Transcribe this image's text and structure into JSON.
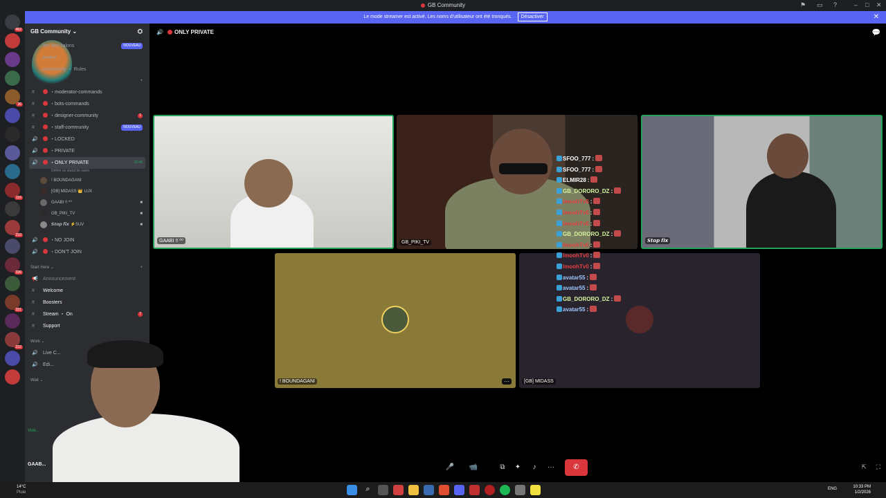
{
  "window": {
    "title": "GB Community",
    "controls": [
      "–",
      "□",
      "✕"
    ]
  },
  "banner": {
    "text": "Le mode streamer est activé. Les noms d'utilisateur ont été tronqués.",
    "button": "Désactiver"
  },
  "server": {
    "name": "GB Community ⌄",
    "top_items": [
      {
        "label": "...ber des salons",
        "badge": "NOUVEAU"
      },
      {
        "label": "...erveur",
        "badge": ""
      },
      {
        "label": "...community ・ Rules",
        "badge": ""
      }
    ],
    "categories": [
      {
        "title": "",
        "channels": [
          {
            "label": "・moderator-commands",
            "badge": ""
          },
          {
            "label": "・bots-commands",
            "badge": ""
          },
          {
            "label": "・designer-community",
            "badge": "1"
          },
          {
            "label": "・staff-community",
            "badge": "NOUVEAU"
          },
          {
            "label": "・LOCKED",
            "badge": ""
          },
          {
            "label": "・PRIVATE",
            "badge": ""
          }
        ]
      }
    ],
    "active_channel": {
      "label": "・ONLY PRIVATE",
      "duration": "32:46",
      "status": "Définir un statut de salon"
    },
    "voice_users": [
      {
        "name": "! BOUNDAGANI",
        "cam": false
      },
      {
        "name": "[GB] MIDASS 👑 LUX",
        "cam": false
      },
      {
        "name": "GAABI !! ⁰⁰",
        "cam": true
      },
      {
        "name": "GB_PIKI_TV",
        "cam": true
      },
      {
        "name": "𝙎𝙩𝙤𝙥 𝙛𝙞𝙭 ⚡SUV",
        "cam": true
      }
    ],
    "after_channels": [
      {
        "label": "・NO JOIN"
      },
      {
        "label": "・DON'T JOIN"
      }
    ],
    "start_here": {
      "title": "Start Here ⌄",
      "channels": [
        {
          "label": "Announcement",
          "badge": ""
        },
        {
          "label": "Welcome",
          "badge": ""
        },
        {
          "label": "Boosters",
          "badge": ""
        },
        {
          "label": "Stream ・ On",
          "badge": "7"
        },
        {
          "label": "Support",
          "badge": ""
        }
      ]
    },
    "work": {
      "title": "Work ⌄",
      "channels": [
        {
          "label": "Live C..."
        },
        {
          "label": "Edi..."
        }
      ]
    },
    "wait": {
      "title": "Wait ⌄"
    },
    "user_panel": {
      "name": "GAAB...",
      "video_label": "Vidé..."
    }
  },
  "call": {
    "channel_title": "ONLY PRIVATE",
    "tiles": [
      {
        "name": "GAABI !! ⁰⁰"
      },
      {
        "name": "GB_PIKI_TV"
      },
      {
        "name": "𝙎𝙩𝙤𝙥 𝙛𝙞𝙭"
      },
      {
        "name": "! BOUNDAGANI"
      },
      {
        "name": "[GB] MIDASS"
      }
    ],
    "more_label": "···"
  },
  "stream_chat": [
    {
      "user": "SFOO_777",
      "color": "#ffffff",
      "sep": ":"
    },
    {
      "user": "SFOO_777",
      "color": "#ffffff",
      "sep": ":"
    },
    {
      "user": "ELMIR28",
      "color": "#ffffff",
      "sep": ":"
    },
    {
      "user": "GB_DORORO_DZ",
      "color": "#d6f5a0",
      "sep": ":"
    },
    {
      "user": "lmoohTv0",
      "color": "#e04040",
      "sep": ":"
    },
    {
      "user": "lmoohTv0",
      "color": "#e04040",
      "sep": ":"
    },
    {
      "user": "lmoohTv0",
      "color": "#e04040",
      "sep": ":"
    },
    {
      "user": "GB_DORORO_DZ",
      "color": "#d6f5a0",
      "sep": ":"
    },
    {
      "user": "lmoohTv0",
      "color": "#e04040",
      "sep": ":"
    },
    {
      "user": "lmoohTv0",
      "color": "#e04040",
      "sep": ":"
    },
    {
      "user": "lmoohTv0",
      "color": "#e04040",
      "sep": ":"
    },
    {
      "user": "avatar55",
      "color": "#a0c8ff",
      "sep": ":"
    },
    {
      "user": "avatar55",
      "color": "#a0c8ff",
      "sep": ":"
    },
    {
      "user": "GB_DORORO_DZ",
      "color": "#d6f5a0",
      "sep": ":"
    },
    {
      "user": "avatar55",
      "color": "#a0c8ff",
      "sep": ":"
    }
  ],
  "callbar": {
    "mic": "🎤",
    "cam": "📹",
    "screen": "⧉",
    "activities": "✦",
    "soundboard": "♪",
    "more": "···",
    "end": "✆"
  },
  "taskbar": {
    "weather": "14°C",
    "weather_sub": "Pluie",
    "lang": "ENG",
    "time": "10:33 PM",
    "date": "1/2/2026"
  },
  "colors": {
    "accent": "#5865f2",
    "danger": "#da373c",
    "online": "#23a559"
  }
}
